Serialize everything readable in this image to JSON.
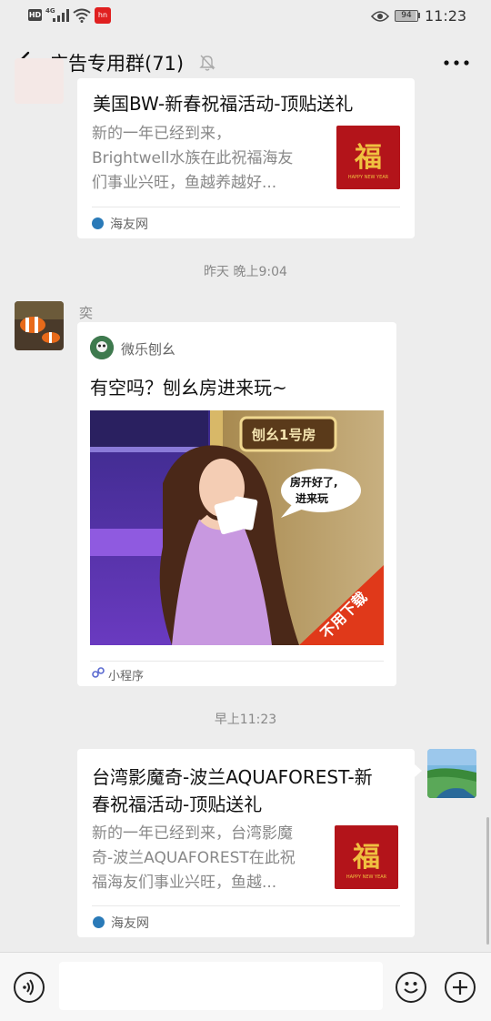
{
  "status_bar": {
    "hd": "HD",
    "network": "4G",
    "app_badge": "hn",
    "battery": "94",
    "time": "11:23"
  },
  "header": {
    "title": "广告专用群(71)"
  },
  "messages": [
    {
      "card_title": "美国BW-新春祝福活动-顶贴送礼",
      "card_desc": "新的一年已经到来，Brightwell水族在此祝福海友们事业兴旺，鱼越养越好...",
      "desc_lines": [
        "新的一年已经到来，",
        "Brightwell水族在此祝福海友",
        "们事业兴旺，鱼越养越好..."
      ],
      "thumb_char": "福",
      "thumb_caption": "HAPPY NEW YEAR",
      "source": "海友网"
    }
  ],
  "timestamp_1": "昨天 晚上9:04",
  "sender_name": "奕",
  "mini_program": {
    "app_name": "微乐刨幺",
    "title": "有空吗？刨幺房进来玩~",
    "banner_text": "刨幺1号房",
    "bubble_text_1": "房开好了,",
    "bubble_text_2": "进来玩",
    "ribbon_text": "不用下载",
    "footer": "小程序"
  },
  "timestamp_2": "早上11:23",
  "my_message": {
    "title_lines": [
      "台湾影魔奇-波兰AQUAFOREST-新",
      "春祝福活动-顶贴送礼"
    ],
    "desc_lines": [
      "新的一年已经到来，台湾影魔",
      "奇-波兰AQUAFOREST在此祝",
      "福海友们事业兴旺，鱼越..."
    ],
    "thumb_char": "福",
    "thumb_caption": "HAPPY NEW YEAR",
    "source": "海友网"
  },
  "icons": [
    "voice-icon",
    "emoji-icon",
    "plus-icon",
    "back-icon",
    "mute-bell-icon",
    "more-icon"
  ]
}
